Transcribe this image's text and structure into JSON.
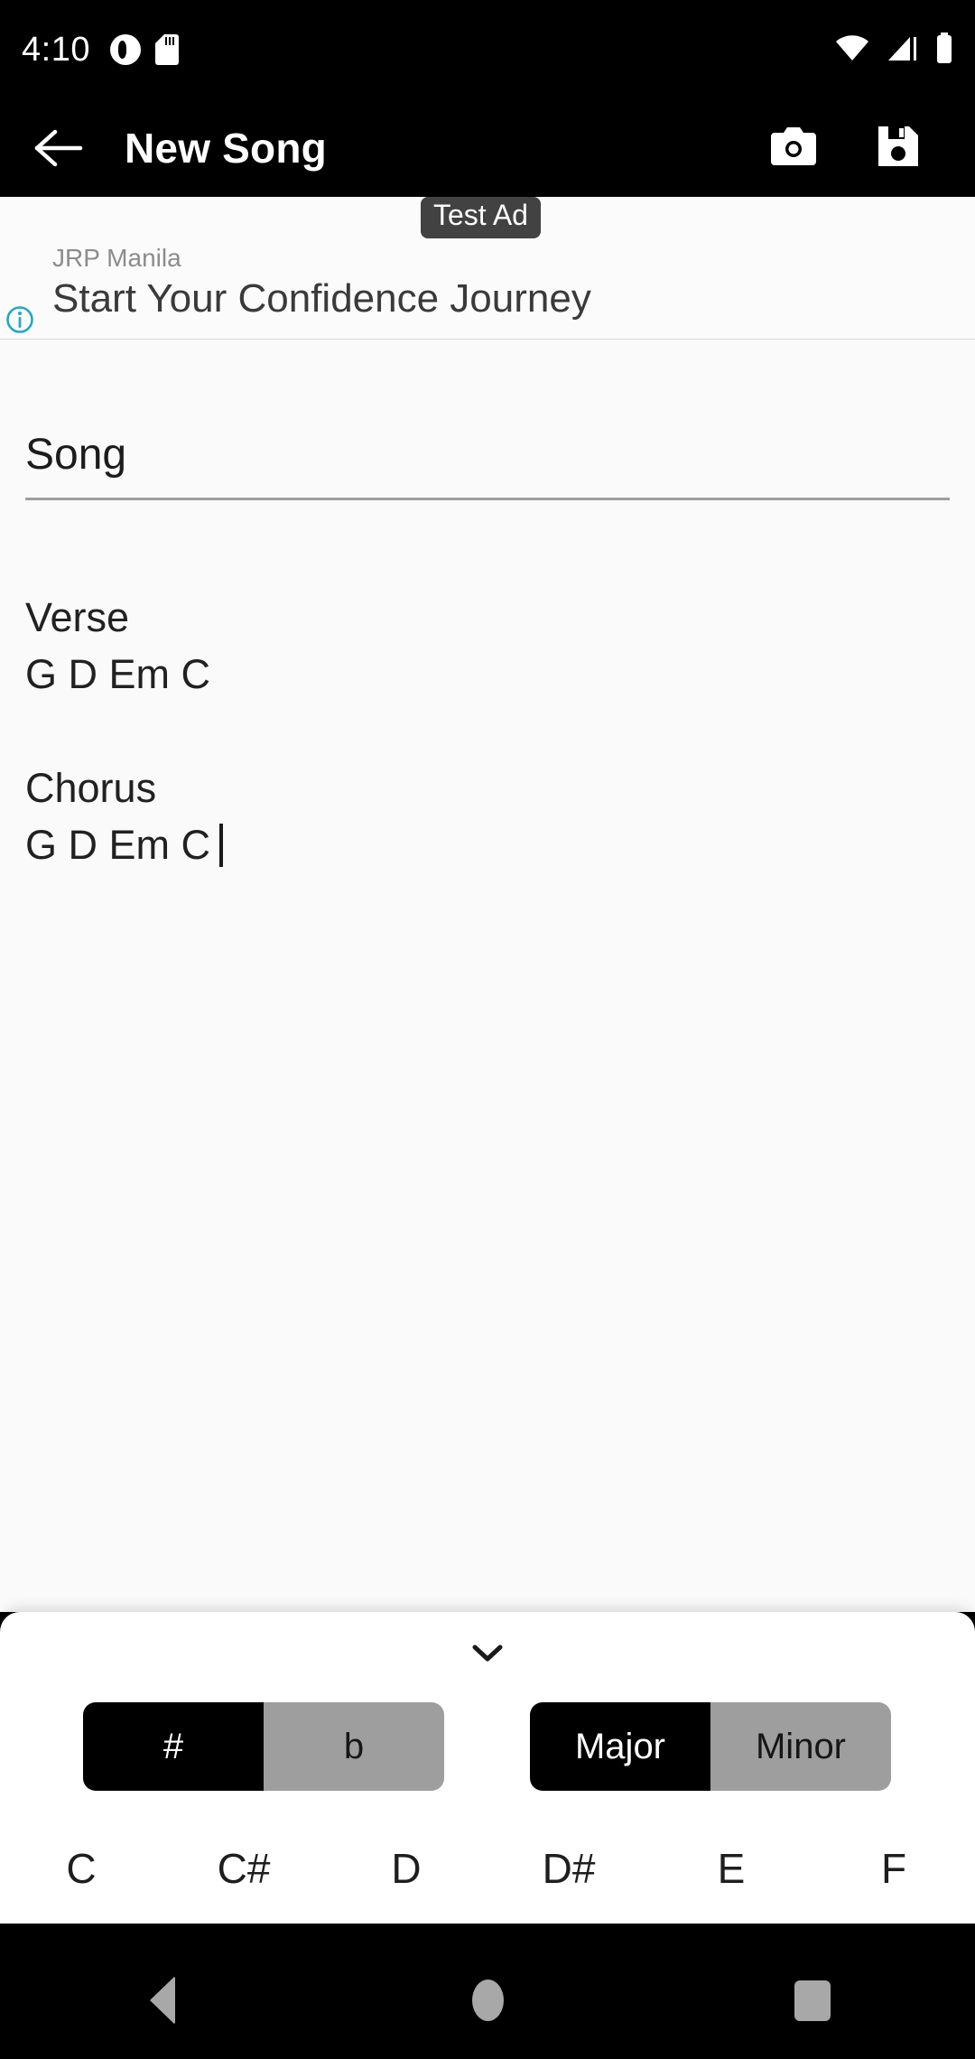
{
  "status_bar": {
    "time": "4:10",
    "left_icons": [
      "notification-circle-icon",
      "sd-card-icon"
    ],
    "right_icons": [
      "wifi-icon",
      "cellular-signal-icon",
      "battery-icon"
    ]
  },
  "app_bar": {
    "back_label": "back-arrow",
    "title": "New Song",
    "camera_label": "camera-icon",
    "save_label": "save-icon"
  },
  "ad": {
    "advertiser": "JRP Manila",
    "headline": "Start Your Confidence Journey",
    "badge": "Test Ad",
    "info_icon": "info-icon",
    "close_icon": "close-icon",
    "accent_color": "#21a8c6",
    "cta_color": "#434343"
  },
  "editor": {
    "title_value": "Song",
    "title_placeholder": "Title",
    "body_text": "Verse\nG D Em C\n\nChorus\nG D Em C"
  },
  "chord_panel": {
    "collapse_icon": "chevron-down-icon",
    "accidental": {
      "options": [
        "#",
        "b"
      ],
      "selected": "#"
    },
    "quality": {
      "options": [
        "Major",
        "Minor"
      ],
      "selected": "Major"
    },
    "notes": [
      "C",
      "C#",
      "D",
      "D#",
      "E",
      "F"
    ]
  },
  "nav_bar": {
    "back": "back-nav-icon",
    "home": "home-nav-icon",
    "recents": "recents-nav-icon"
  },
  "colors": {
    "appbar_bg": "#000000",
    "content_bg": "#fafafa",
    "sheet_bg": "#ffffff",
    "selected_segment": "#000000",
    "unselected_segment": "#9e9e9e"
  }
}
